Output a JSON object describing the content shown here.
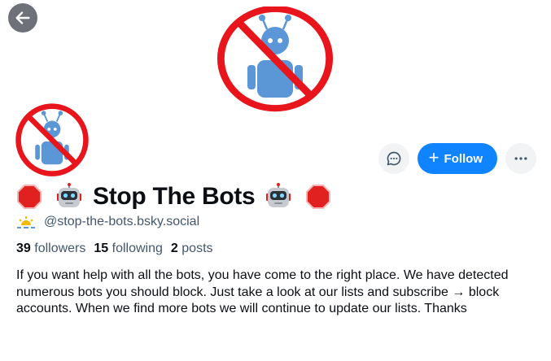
{
  "profile": {
    "display_name": "Stop The Bots",
    "handle": "@stop-the-bots.bsky.social",
    "followers_count": "39",
    "followers_label": "followers",
    "following_count": "15",
    "following_label": "following",
    "posts_count": "2",
    "posts_label": "posts",
    "bio": "If you want help with all the bots, you have come to the right place. We have detected numerous bots you should block. Just take a look at our lists and subscribe → block accounts. When we find more bots we will continue to update our lists. Thanks"
  },
  "actions": {
    "follow_label": "Follow",
    "follow_icon": "plus-icon",
    "message_icon": "chat-bubble-icon",
    "more_icon": "ellipsis-icon",
    "back_icon": "arrow-left-icon"
  },
  "colors": {
    "accent": "#1083fe",
    "prohibited_red": "#e8151c",
    "robot_blue": "#5b96d6",
    "stop_sign": "#e0211f"
  }
}
